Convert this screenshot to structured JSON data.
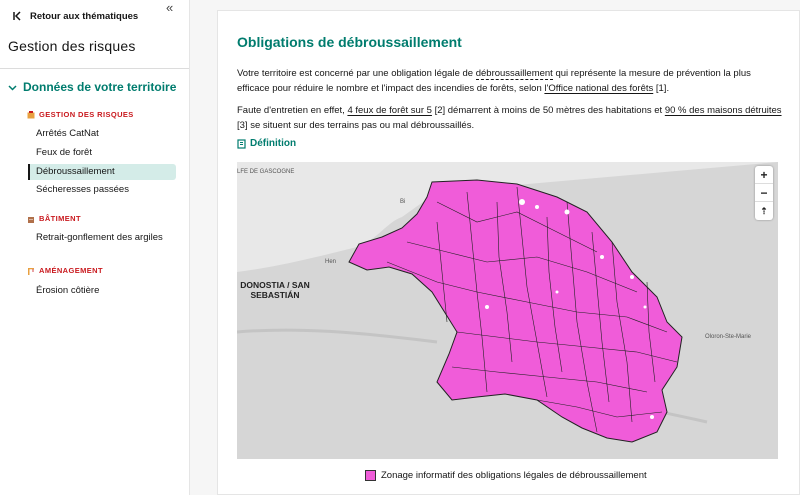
{
  "sidebar": {
    "back_label": "Retour aux thématiques",
    "title": "Gestion des risques",
    "section_label": "Données de votre territoire",
    "groups": [
      {
        "label": "GESTION DES RISQUES",
        "color": "#c9191e",
        "items": [
          "Arrêtés CatNat",
          "Feux de forêt",
          "Débroussaillement",
          "Sécheresses passées"
        ]
      },
      {
        "label": "BÂTIMENT",
        "color": "#c9191e",
        "items": [
          "Retrait-gonflement des argiles"
        ]
      },
      {
        "label": "AMÉNAGEMENT",
        "color": "#c9191e",
        "items": [
          "Érosion côtière"
        ]
      }
    ],
    "active_item": "Débroussaillement"
  },
  "main": {
    "title": "Obligations de débroussaillement",
    "para1": {
      "t1": "Votre territoire est concerné par une obligation légale de ",
      "link1": "débroussaillement",
      "t2": " qui représente la mesure de prévention la plus efficace pour réduire le nombre et l'impact des incendies de forêts, selon ",
      "link2": "l'Office national des forêts",
      "t3": " [1]."
    },
    "para2": {
      "t1": "Faute d'entretien en effet, ",
      "link1": "4 feux de forêt sur 5",
      "t2": " [2] démarrent à moins de 50 mètres des habitations et ",
      "link2": "90 % des maisons détruites",
      "t3": " [3] se situent sur des terrains pas ou mal débroussaillés."
    },
    "definition_label": "Définition"
  },
  "map": {
    "labels": {
      "gulf": "LFE DE GASCOGNE",
      "city": "DONOSTIA / SAN SEBASTIÁN",
      "oloron": "Oloron-Ste-Marie",
      "biarritz": "Bi",
      "hendaye": "Hen"
    },
    "zoom_in": "+",
    "zoom_out": "−",
    "reset": "⇡",
    "fill_color": "#f05cd9",
    "land_color": "#d9d9d9"
  },
  "legend": {
    "label": "Zonage informatif des obligations légales de débroussaillement"
  },
  "colors": {
    "accent": "#007c6e",
    "danger": "#c9191e",
    "active_bg": "#d4ece8"
  }
}
